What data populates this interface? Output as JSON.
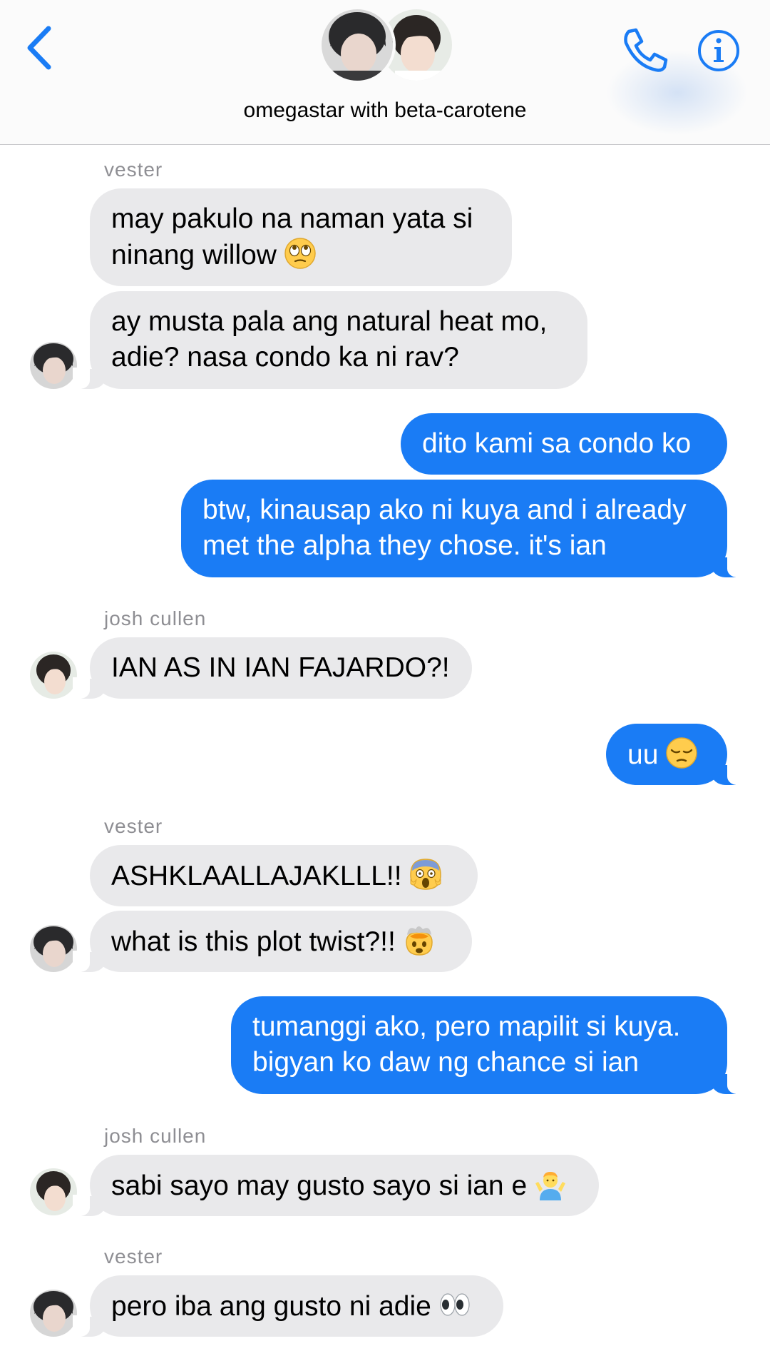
{
  "header": {
    "title": "omegastar with beta-carotene",
    "icons": {
      "back": "chevron-left-icon",
      "call": "phone-icon",
      "info": "info-icon"
    }
  },
  "colors": {
    "accent": "#1a7cf5",
    "incoming_bubble": "#e9e9eb",
    "sender_label": "#8e8e93"
  },
  "messages": [
    {
      "sender": "vester"
    },
    {
      "text": "may pakulo na naman yata si",
      "text2": "ninang willow",
      "emoji": "face-with-rolling-eyes-emoji"
    },
    {
      "text": "ay musta pala ang natural heat mo,",
      "text2": "adie? nasa condo ka ni rav?"
    },
    {
      "text": "dito kami sa condo ko"
    },
    {
      "text": "btw, kinausap ako ni kuya and i already",
      "text2": "met the alpha they chose. it's ian"
    },
    {
      "sender": "josh cullen"
    },
    {
      "text": "IAN AS IN IAN FAJARDO?!"
    },
    {
      "text": "uu",
      "emoji": "pensive-face-emoji"
    },
    {
      "sender": "vester"
    },
    {
      "text": "ASHKLAALLAJAKLLL!!",
      "emoji": "face-screaming-in-fear-emoji"
    },
    {
      "text": "what is this plot twist?!!",
      "emoji": "exploding-head-emoji"
    },
    {
      "text": "tumanggi ako, pero mapilit si kuya.",
      "text2": "bigyan ko daw ng chance si ian"
    },
    {
      "sender": "josh cullen"
    },
    {
      "text": "sabi sayo may gusto sayo si ian e",
      "emoji": "person-shrugging-emoji"
    },
    {
      "sender": "vester"
    },
    {
      "text": "pero iba ang gusto ni adie",
      "emoji": "eyes-emoji"
    }
  ]
}
